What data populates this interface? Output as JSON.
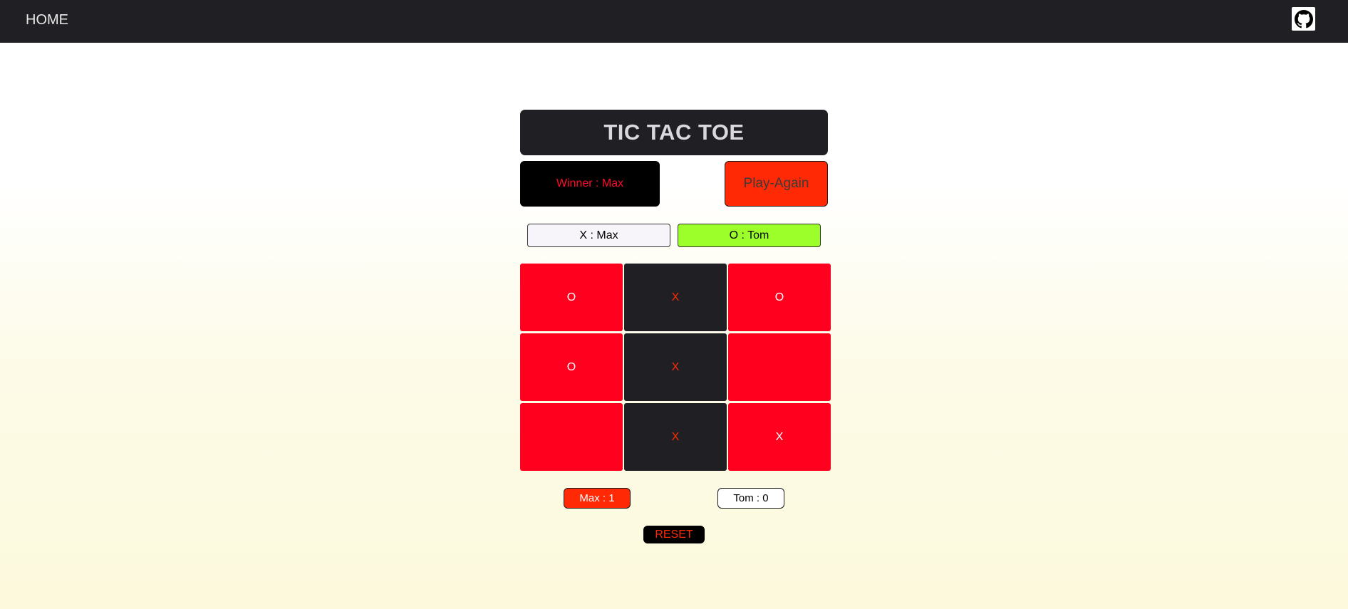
{
  "nav": {
    "home_label": "HOME",
    "github_icon": "github-icon"
  },
  "game": {
    "title": "TIC TAC TOE",
    "winner_text": "Winner : Max",
    "play_again_label": "Play-Again",
    "player_x_label": "X : Max",
    "player_o_label": "O : Tom",
    "active_player": "O",
    "board": [
      [
        "O",
        "X",
        "O"
      ],
      [
        "O",
        "X",
        ""
      ],
      [
        "",
        "X",
        "X"
      ]
    ],
    "score_max": "Max : 1",
    "score_tom": "Tom : 0",
    "reset_label": "RESET"
  },
  "colors": {
    "navbar": "#202024",
    "title_bg": "#202024",
    "cell_red": "#ff001e",
    "cell_dark": "#202024",
    "accent_orange": "#ff2a05",
    "active_player_green": "#9dff2a",
    "winner_text": "#ff0a28"
  }
}
